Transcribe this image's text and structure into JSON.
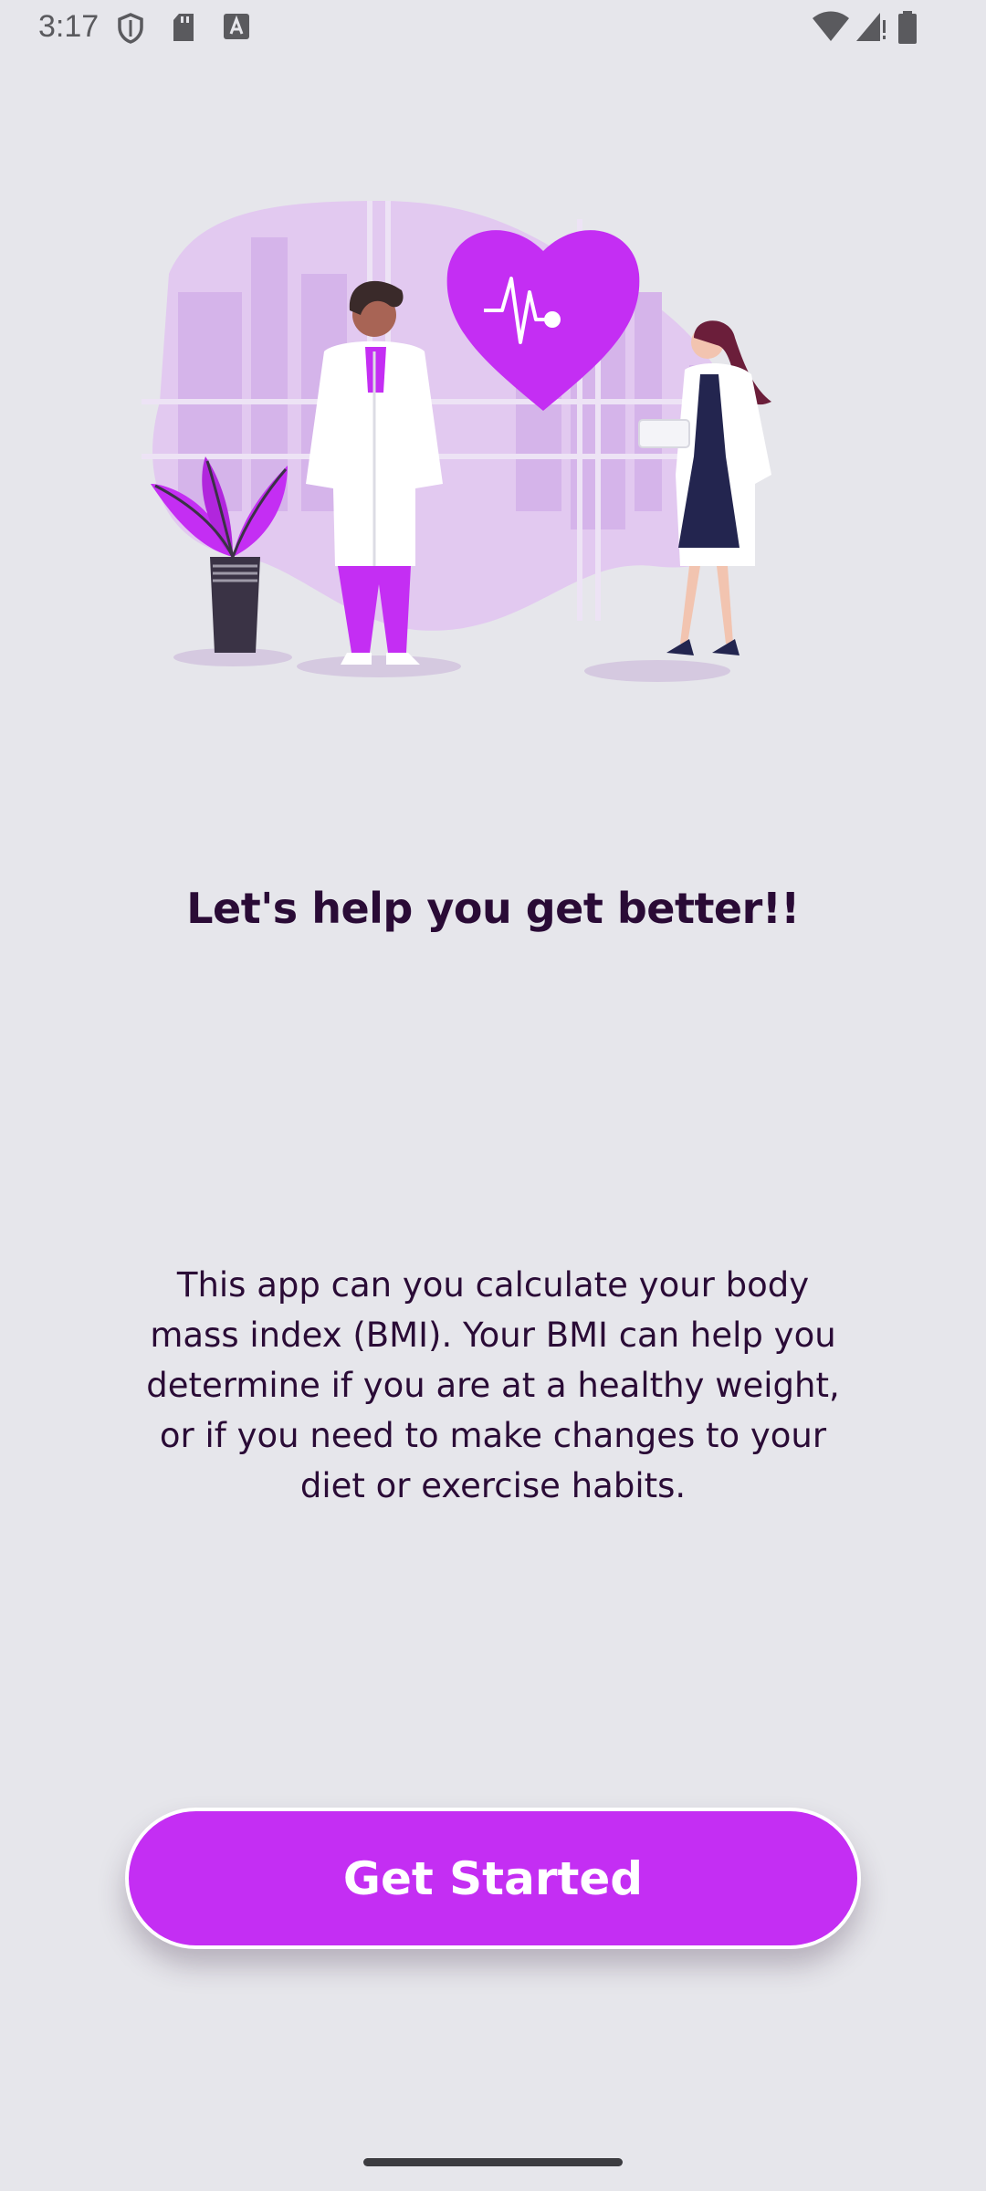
{
  "status_bar": {
    "time": "3:17"
  },
  "onboarding": {
    "headline": "Let's help you get better!!",
    "description": "This app can you calculate your body mass index (BMI). Your BMI can help you determine if you are at a healthy weight, or if you need to make changes to your diet or exercise habits.",
    "cta_label": "Get Started"
  },
  "colors": {
    "background": "#e6e6eb",
    "accent": "#c42ef3",
    "text": "#2a0b36"
  }
}
